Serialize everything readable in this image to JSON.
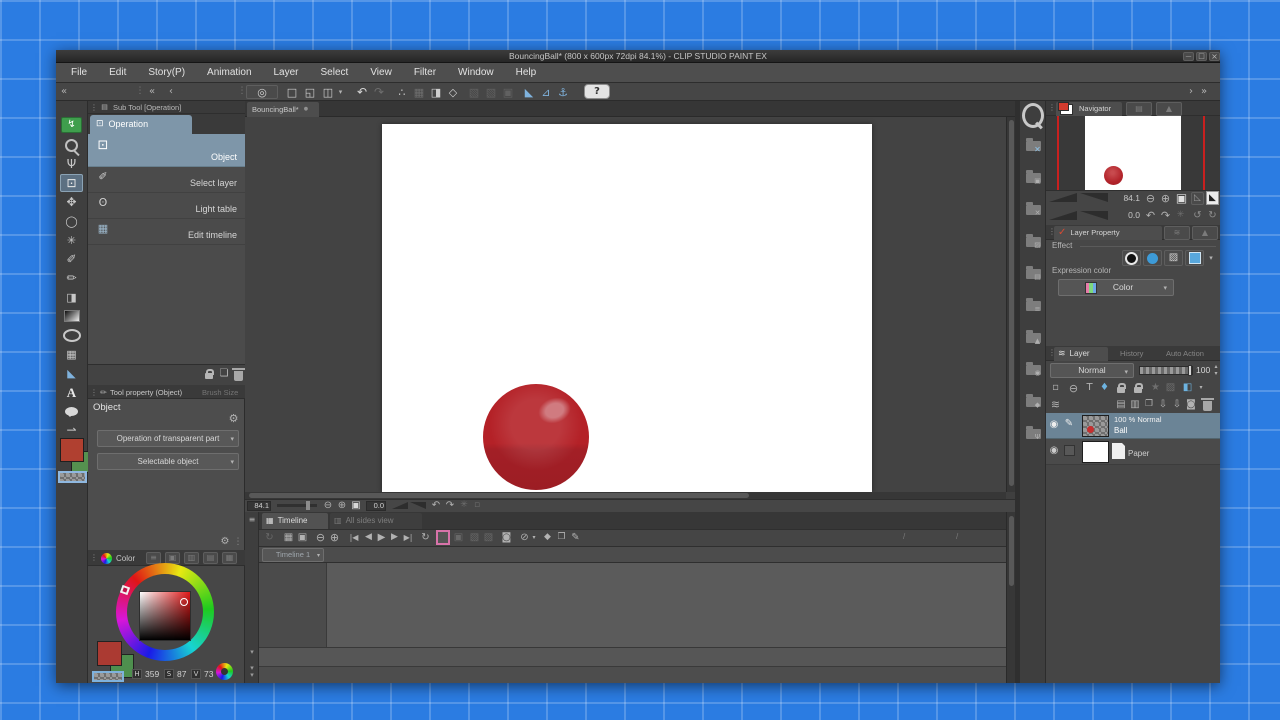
{
  "window": {
    "title": "BouncingBall* (800 x 600px 72dpi 84.1%)  - CLIP STUDIO PAINT EX",
    "btn_min": "—",
    "btn_max": "□",
    "btn_close": "×"
  },
  "menubar": {
    "items": [
      "File",
      "Edit",
      "Story(P)",
      "Animation",
      "Layer",
      "Select",
      "View",
      "Filter",
      "Window",
      "Help"
    ]
  },
  "toolbar": {
    "collapse_left": "«",
    "grip1": "⋮",
    "collapse2": "«",
    "chev": "‹",
    "grip2": "⋮",
    "logo": "◎",
    "new_file": "□",
    "open_file": "◱",
    "save_file": "◫",
    "save_arrow": "▾",
    "undo": "↶",
    "redo": "↷",
    "move_parts": "∴",
    "mesh": "▦",
    "paint": "◨",
    "transform": "◇",
    "dim1": "▧",
    "dim2": "▧",
    "dim3": "▣",
    "snap1": "◣",
    "snap2": "⊿",
    "snap3": "⚓",
    "help": "?",
    "chev_right": "›",
    "collapse_right": "»"
  },
  "toolbox": {
    "green": "↯",
    "hand": "Ψ",
    "operation": "⊡",
    "move": "✥",
    "lasso": "◯",
    "wand": "✳",
    "dropper": "✐",
    "brush": "✏",
    "bucket": "◨",
    "frame": "▦",
    "ruler": "◣",
    "text": "A",
    "flow": "⇀"
  },
  "subtool": {
    "header": "Sub Tool [Operation]",
    "header_icon": "▤",
    "tab": "Operation",
    "tab_icon": "⊡",
    "items": [
      {
        "icon": "⊡",
        "label": "Object"
      },
      {
        "icon": "✐",
        "label": "Select layer"
      },
      {
        "icon": "ʘ",
        "label": "Light table"
      },
      {
        "icon": "▦",
        "label": "Edit timeline"
      }
    ],
    "page_icon": "❏"
  },
  "toolprop": {
    "tab": "Tool property (Object)",
    "tab_icon": "✏",
    "tab2": "Brush Size",
    "heading": "Object",
    "wrench": "⚙",
    "dropdown1": "Operation of transparent part",
    "dropdown2": "Selectable object",
    "arrow": "▾",
    "gear": "⚙",
    "more": "⋮"
  },
  "colorpanel": {
    "tab": "Color",
    "tabs_dim": [
      "≡",
      "▣",
      "▥",
      "▤",
      "▦"
    ],
    "h_label": "H",
    "h_value": "359",
    "s_label": "S",
    "s_value": "87",
    "v_label": "V",
    "v_value": "73"
  },
  "canvas": {
    "tab": "BouncingBall*",
    "close_dot": "●",
    "zoom": "84.1",
    "rotation": "0.0",
    "zoom_out": "⊖",
    "zoom_in": "⊕",
    "fit": "▣",
    "rot_ccw": "↶",
    "rot_cw": "↷",
    "reset": "✳",
    "extra": "▫"
  },
  "timeline": {
    "grip": "≡",
    "tab1": "Timeline",
    "tab1_icon": "▦",
    "tab2": "All sides view",
    "tab2_icon": "▥",
    "icons": {
      "loop_dim": "↻",
      "tl1": "▦",
      "tl2": "▣",
      "zoom_out": "⊖",
      "zoom_in": "⊕",
      "first": "|◀",
      "prev": "◀",
      "play": "▶",
      "next": "▶",
      "last": "▶|",
      "loop": "↻",
      "cel_dim": "▣",
      "onion1": "▧",
      "onion2": "▧",
      "enable": "◙",
      "mode": "⊘",
      "mode_arrow": "▾",
      "keyframe": "◆",
      "cel2": "❐",
      "pen": "✎"
    },
    "slash1": "/",
    "slash2": "/",
    "selector": "Timeline 1",
    "selector_arrow": "▾",
    "collapse1": "▾",
    "collapse2": "▾",
    "collapse3": "▾"
  },
  "dock": {
    "overlay_x": "✕",
    "overlays": [
      "▣",
      "✕",
      "▨",
      "▤",
      "≡",
      "▲",
      "◉",
      "◆",
      "Ψ"
    ]
  },
  "navigator": {
    "tab": "Navigator",
    "tab2_icon": "▤",
    "tab3_icon": "▲",
    "zoom": "84.1",
    "zoom_out": "⊖",
    "zoom_in": "⊕",
    "fit": "▣",
    "flip1": "◺",
    "flip2": "◣",
    "rotation": "0.0",
    "rot_ccw": "↶",
    "rot_cw": "↷",
    "reset": "✳",
    "rot2": "↺",
    "rot3": "↻"
  },
  "layerprop": {
    "check": "✓",
    "tab": "Layer Property",
    "tab2_icon": "≋",
    "tab3_icon": "▲",
    "effect_label": "Effect",
    "fx_halftone": "▨",
    "fx_arrow": "▾",
    "expression_label": "Expression color",
    "color_dropdown": "Color",
    "arrow": "▾"
  },
  "layers": {
    "tab_icon": "≋",
    "tab": "Layer",
    "tab2": "History",
    "tab3": "Auto Action",
    "blend": "Normal",
    "arrow": "▾",
    "opacity": "100",
    "spin_up": "▴",
    "spin_down": "▾",
    "row_icons1": [
      "▫",
      "⊖",
      "T",
      "♦"
    ],
    "star": "★",
    "halftone": "▨",
    "layercolor": "◧",
    "row_icons2": [
      "▤",
      "▥",
      "❐",
      "⇩",
      "⇩",
      "◙"
    ],
    "waves": "≋",
    "eye": "◉",
    "pencil": "✎",
    "rows": [
      {
        "info": "100 % Normal",
        "name": "Ball"
      },
      {
        "name": "Paper"
      }
    ]
  }
}
